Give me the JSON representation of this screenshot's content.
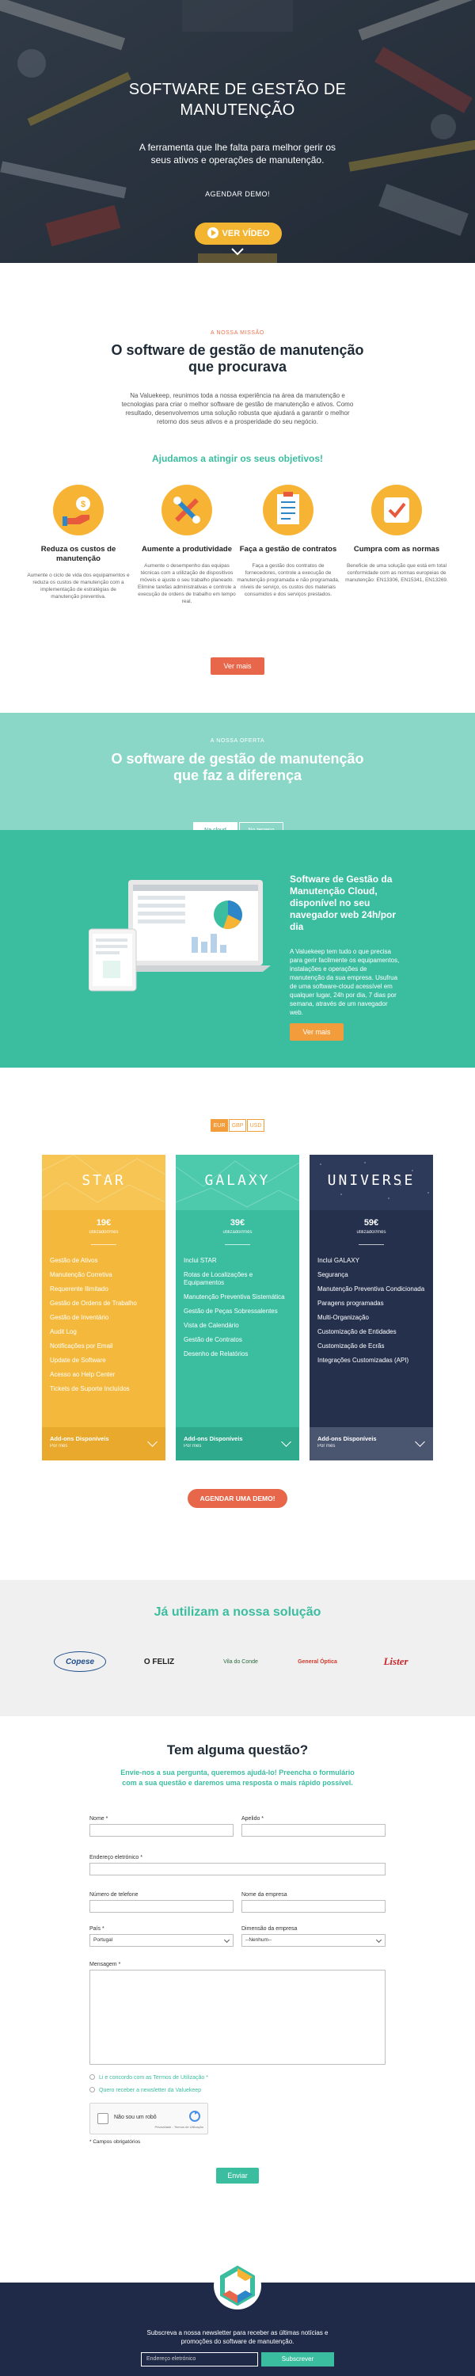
{
  "colors": {
    "teal": "#3bbd9f",
    "orange": "#e8674a",
    "yellow": "#f7b334",
    "navy": "#1e2a47"
  },
  "hero": {
    "title": "SOFTWARE DE GESTÃO DE MANUTENÇÃO",
    "subtitle": "A ferramenta que lhe falta para melhor gerir os seus ativos e operações de manutenção.",
    "demo_link": "AGENDAR DEMO!",
    "video_button": "VER VÍDEO"
  },
  "mission": {
    "eyebrow": "A NOSSA MISSÃO",
    "title": "O software de gestão de manutenção que procurava",
    "paragraph": "Na Valuekeep, reunimos toda a nossa experiência na área da manutenção e tecnologias para criar o melhor software de gestão de manutenção e ativos. Como resultado, desenvolvemos uma solução robusta que ajudará a garantir o melhor retorno dos seus ativos e a prosperidade do seu negócio.",
    "helps_title": "Ajudamos a atingir os seus objetivos!",
    "features": [
      {
        "icon": "coin-hand-icon",
        "title": "Reduza os custos de manutenção",
        "desc": "Aumente o ciclo de vida dos equipamentos e reduza os custos de manutenção com a implementação de estratégias de manutenção preventiva."
      },
      {
        "icon": "tools-icon",
        "title": "Aumente a produtividade",
        "desc": "Aumente o desempenho das equipas técnicas com a utilização de dispositivos móveis e ajuste o seu trabalho planeado. Elimine tarefas administrativas e controle a execução de ordens de trabalho em tempo real."
      },
      {
        "icon": "checklist-icon",
        "title": "Faça a gestão de contratos",
        "desc": "Faça a gestão dos contratos de fornecedores, controle a execução de manutenção programada e não programada, níveis de serviço, os custos dos materiais consumidos e dos serviços prestados."
      },
      {
        "icon": "checkmark-badge-icon",
        "title": "Cumpra com as normas",
        "desc": "Beneficie de uma solução que está em total conformidade com as normas europeias de manutenção: EN13306, EN15341, EN13269."
      }
    ],
    "more_button": "Ver mais"
  },
  "offer": {
    "eyebrow": "A NOSSA OFERTA",
    "title": "O software de gestão de manutenção que faz a diferença",
    "tabs": [
      "Na cloud",
      "No terreno"
    ],
    "card_title": "Software de Gestão da Manutenção Cloud, disponível no seu navegador web 24h/por dia",
    "card_desc": "A Valuekeep tem tudo o que precisa para gerir facilmente os equipamentos, instalações e operações de manutenção da sua empresa. Usufrua de uma software-cloud acessível em qualquer lugar, 24h por dia, 7 dias por semana, através de um navegador web.",
    "more_button": "Ver mais"
  },
  "pricing": {
    "currencies": [
      "EUR",
      "GBP",
      "USD"
    ],
    "plans": [
      {
        "name": "STAR",
        "price": "19€",
        "unit": "utilizador/mês",
        "items": [
          "Gestão de Ativos",
          "Manutenção Corretiva",
          "Requerente Ilimitado",
          "Gestão de Ordens de Trabalho",
          "Gestão de Inventário",
          "Audit Log",
          "Notificações por Email",
          "Update de Software",
          "Acesso ao Help Center",
          "Tickets de Suporte Incluídos"
        ],
        "addon": "Add-ons Disponíveis",
        "addon_unit": "Por mês"
      },
      {
        "name": "GALAXY",
        "price": "39€",
        "unit": "utilizador/mês",
        "items": [
          "Inclui STAR",
          "Rotas de Localizações e Equipamentos",
          "Manutenção Preventiva Sistemática",
          "Gestão de Peças Sobressalentes",
          "Vista de Calendário",
          "Gestão de Contratos",
          "Desenho de Relatórios"
        ],
        "addon": "Add-ons Disponíveis",
        "addon_unit": "Por mês"
      },
      {
        "name": "UNIVERSE",
        "price": "59€",
        "unit": "utilizador/mês",
        "items": [
          "Inclui GALAXY",
          "Segurança",
          "Manutenção Preventiva Condicionada",
          "Paragens programadas",
          "Multi-Organização",
          "Customização de Entidades",
          "Customização de Ecrãs",
          "Integrações Customizadas (API)"
        ],
        "addon": "Add-ons Disponíveis",
        "addon_unit": "Por mês"
      }
    ],
    "demo_button": "AGENDAR UMA DEMO!"
  },
  "clients": {
    "title": "Já utilizam a nossa solução",
    "logos": [
      "Copese",
      "O FELIZ",
      "Vila do Conde",
      "General Óptica",
      "Lister"
    ]
  },
  "form": {
    "title": "Tem alguma questão?",
    "intro": "Envie-nos a sua pergunta, queremos ajudá-lo! Preencha o formulário com a sua questão e daremos uma resposta o mais rápido possível.",
    "labels": {
      "name": "Nome *",
      "surname": "Apelido *",
      "email": "Endereço eletrónico *",
      "phone": "Número de telefone",
      "company": "Nome da empresa",
      "country": "País *",
      "size": "Dimensão da empresa",
      "message": "Mensagem *"
    },
    "country_value": "Portugal",
    "size_value": "--Nenhum--",
    "terms": "Li e concordo com as Termos de Utilização *",
    "newsletter": "Quero receber a newsletter da Valuekeep",
    "captcha_label": "Não sou um robô",
    "captcha_small": "Privacidade - Termos de Utilização",
    "required_note": "* Campos obrigatórios",
    "send_button": "Enviar"
  },
  "footer": {
    "text": "Subscreva a nossa newsletter para receber as últimas notícias e promoções do software de manutenção.",
    "email_placeholder": "Endereço eletrónico",
    "subscribe_button": "Subscrever"
  }
}
